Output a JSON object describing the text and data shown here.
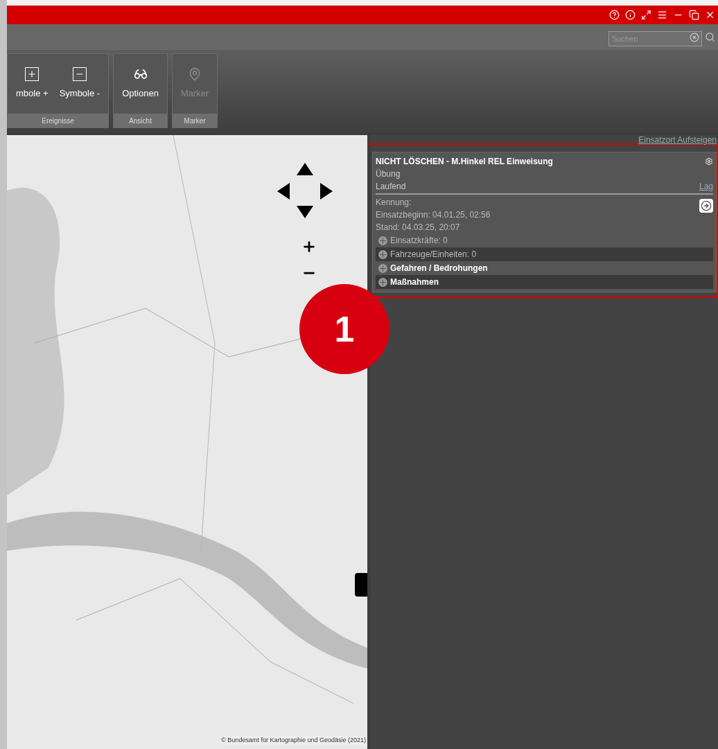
{
  "search": {
    "placeholder": "Suchen"
  },
  "ribbon": {
    "groups": [
      {
        "label": "Ereignisse",
        "buttons": [
          {
            "label": "mbole +",
            "disabled": false
          },
          {
            "label": "Symbole -",
            "disabled": false
          }
        ]
      },
      {
        "label": "Ansicht",
        "buttons": [
          {
            "label": "Optionen",
            "disabled": false
          }
        ]
      },
      {
        "label": "Marker",
        "buttons": [
          {
            "label": "Marker",
            "disabled": true
          }
        ]
      }
    ]
  },
  "map": {
    "attribution": "© Bundesamt für Kartographie und Geodäsie (2021)"
  },
  "panel": {
    "sort_link": "Einsatzort Aufsteigen",
    "card": {
      "title": "NICHT LÖSCHEN - M.Hinkel REL Einweisung",
      "type": "Übung",
      "status": "Laufend",
      "link": "Lag",
      "details": [
        "Kennung:",
        "Einsatzbeginn: 04.01.25, 02:56",
        "Stand: 04.03.25, 20:07"
      ],
      "sections": [
        {
          "label": "Einsatzkräfte: 0",
          "bold": false,
          "expanded": false
        },
        {
          "label": "Fahrzeuge/Einheiten: 0",
          "bold": false,
          "expanded": false
        },
        {
          "label": "Gefahren / Bedrohungen",
          "bold": true,
          "expanded": false
        },
        {
          "label": "Maßnahmen",
          "bold": true,
          "expanded": false
        }
      ]
    }
  },
  "callout": {
    "number": "1"
  }
}
